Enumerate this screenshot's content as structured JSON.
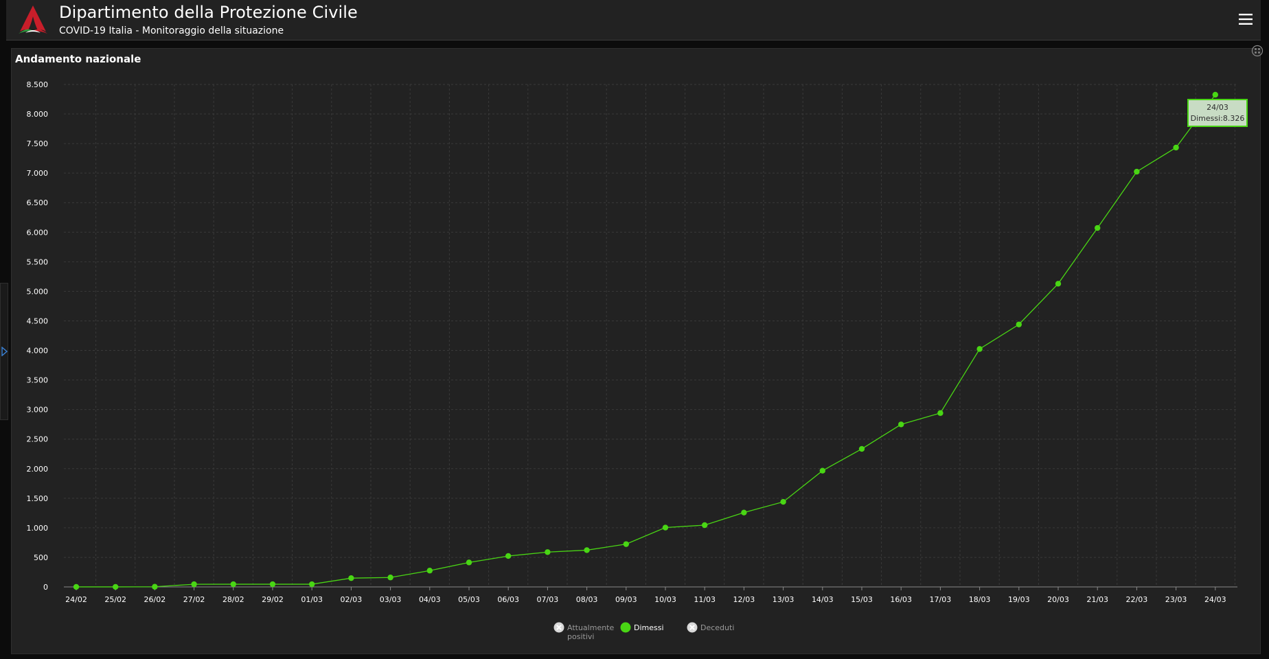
{
  "header": {
    "title": "Dipartimento della Protezione Civile",
    "subtitle": "COVID-19 Italia - Monitoraggio della situazione"
  },
  "icons": {
    "logo": "protezione-civile-logo",
    "menu": "hamburger-menu-icon",
    "expand": "expand-icon",
    "side_panel": "chevron-right-icon"
  },
  "panel": {
    "title": "Andamento nazionale"
  },
  "colors": {
    "series": "#49d614",
    "background": "#222222",
    "grid": "#3a3a3a"
  },
  "legend": {
    "items": [
      {
        "label_line1": "Attualmente",
        "label_line2": "positivi",
        "active": false
      },
      {
        "label_line1": "Dimessi",
        "label_line2": "",
        "active": true
      },
      {
        "label_line1": "Deceduti",
        "label_line2": "",
        "active": false
      }
    ]
  },
  "tooltip": {
    "date": "24/03",
    "label": "Dimessi:8.326"
  },
  "chart_data": {
    "type": "line",
    "title": "",
    "xlabel": "",
    "ylabel": "",
    "categories": [
      "24/02",
      "25/02",
      "26/02",
      "27/02",
      "28/02",
      "29/02",
      "01/03",
      "02/03",
      "03/03",
      "04/03",
      "05/03",
      "06/03",
      "07/03",
      "08/03",
      "09/03",
      "10/03",
      "11/03",
      "12/03",
      "13/03",
      "14/03",
      "15/03",
      "16/03",
      "17/03",
      "18/03",
      "19/03",
      "20/03",
      "21/03",
      "22/03",
      "23/03",
      "24/03"
    ],
    "series": [
      {
        "name": "Dimessi",
        "values": [
          1,
          1,
          3,
          45,
          46,
          46,
          46,
          149,
          160,
          276,
          414,
          523,
          589,
          622,
          724,
          1004,
          1045,
          1258,
          1439,
          1966,
          2335,
          2749,
          2941,
          4025,
          4440,
          5129,
          6072,
          7024,
          7432,
          8326
        ]
      }
    ],
    "ylim": [
      0,
      8500
    ],
    "yticks": [
      0,
      500,
      1000,
      1500,
      2000,
      2500,
      3000,
      3500,
      4000,
      4500,
      5000,
      5500,
      6000,
      6500,
      7000,
      7500,
      8000,
      8500
    ],
    "ytick_labels": [
      "0",
      "500",
      "1.000",
      "1.500",
      "2.000",
      "2.500",
      "3.000",
      "3.500",
      "4.000",
      "4.500",
      "5.000",
      "5.500",
      "6.000",
      "6.500",
      "7.000",
      "7.500",
      "8.000",
      "8.500"
    ],
    "grid": true,
    "legend_position": "bottom"
  }
}
